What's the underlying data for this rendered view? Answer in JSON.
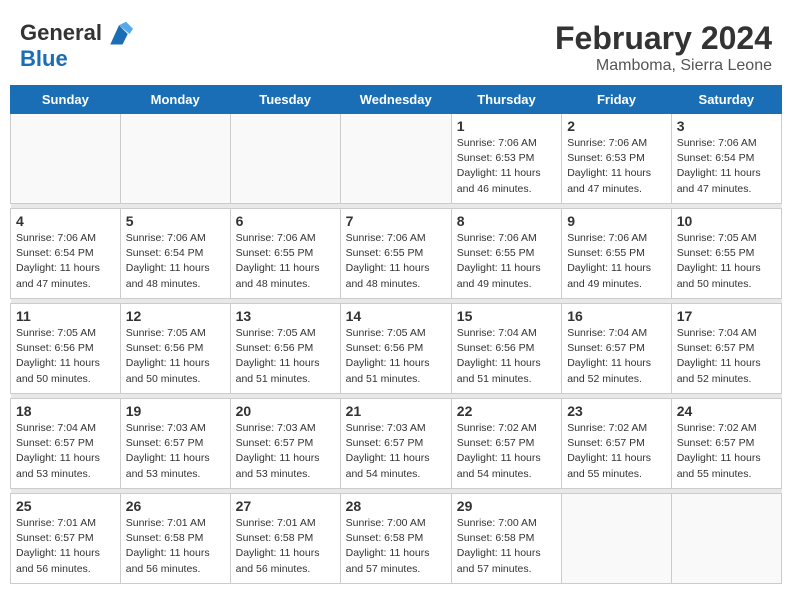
{
  "header": {
    "logo_line1": "General",
    "logo_line2": "Blue",
    "month_year": "February 2024",
    "location": "Mamboma, Sierra Leone"
  },
  "weekdays": [
    "Sunday",
    "Monday",
    "Tuesday",
    "Wednesday",
    "Thursday",
    "Friday",
    "Saturday"
  ],
  "weeks": [
    [
      {
        "day": "",
        "info": ""
      },
      {
        "day": "",
        "info": ""
      },
      {
        "day": "",
        "info": ""
      },
      {
        "day": "",
        "info": ""
      },
      {
        "day": "1",
        "info": "Sunrise: 7:06 AM\nSunset: 6:53 PM\nDaylight: 11 hours\nand 46 minutes."
      },
      {
        "day": "2",
        "info": "Sunrise: 7:06 AM\nSunset: 6:53 PM\nDaylight: 11 hours\nand 47 minutes."
      },
      {
        "day": "3",
        "info": "Sunrise: 7:06 AM\nSunset: 6:54 PM\nDaylight: 11 hours\nand 47 minutes."
      }
    ],
    [
      {
        "day": "4",
        "info": "Sunrise: 7:06 AM\nSunset: 6:54 PM\nDaylight: 11 hours\nand 47 minutes."
      },
      {
        "day": "5",
        "info": "Sunrise: 7:06 AM\nSunset: 6:54 PM\nDaylight: 11 hours\nand 48 minutes."
      },
      {
        "day": "6",
        "info": "Sunrise: 7:06 AM\nSunset: 6:55 PM\nDaylight: 11 hours\nand 48 minutes."
      },
      {
        "day": "7",
        "info": "Sunrise: 7:06 AM\nSunset: 6:55 PM\nDaylight: 11 hours\nand 48 minutes."
      },
      {
        "day": "8",
        "info": "Sunrise: 7:06 AM\nSunset: 6:55 PM\nDaylight: 11 hours\nand 49 minutes."
      },
      {
        "day": "9",
        "info": "Sunrise: 7:06 AM\nSunset: 6:55 PM\nDaylight: 11 hours\nand 49 minutes."
      },
      {
        "day": "10",
        "info": "Sunrise: 7:05 AM\nSunset: 6:55 PM\nDaylight: 11 hours\nand 50 minutes."
      }
    ],
    [
      {
        "day": "11",
        "info": "Sunrise: 7:05 AM\nSunset: 6:56 PM\nDaylight: 11 hours\nand 50 minutes."
      },
      {
        "day": "12",
        "info": "Sunrise: 7:05 AM\nSunset: 6:56 PM\nDaylight: 11 hours\nand 50 minutes."
      },
      {
        "day": "13",
        "info": "Sunrise: 7:05 AM\nSunset: 6:56 PM\nDaylight: 11 hours\nand 51 minutes."
      },
      {
        "day": "14",
        "info": "Sunrise: 7:05 AM\nSunset: 6:56 PM\nDaylight: 11 hours\nand 51 minutes."
      },
      {
        "day": "15",
        "info": "Sunrise: 7:04 AM\nSunset: 6:56 PM\nDaylight: 11 hours\nand 51 minutes."
      },
      {
        "day": "16",
        "info": "Sunrise: 7:04 AM\nSunset: 6:57 PM\nDaylight: 11 hours\nand 52 minutes."
      },
      {
        "day": "17",
        "info": "Sunrise: 7:04 AM\nSunset: 6:57 PM\nDaylight: 11 hours\nand 52 minutes."
      }
    ],
    [
      {
        "day": "18",
        "info": "Sunrise: 7:04 AM\nSunset: 6:57 PM\nDaylight: 11 hours\nand 53 minutes."
      },
      {
        "day": "19",
        "info": "Sunrise: 7:03 AM\nSunset: 6:57 PM\nDaylight: 11 hours\nand 53 minutes."
      },
      {
        "day": "20",
        "info": "Sunrise: 7:03 AM\nSunset: 6:57 PM\nDaylight: 11 hours\nand 53 minutes."
      },
      {
        "day": "21",
        "info": "Sunrise: 7:03 AM\nSunset: 6:57 PM\nDaylight: 11 hours\nand 54 minutes."
      },
      {
        "day": "22",
        "info": "Sunrise: 7:02 AM\nSunset: 6:57 PM\nDaylight: 11 hours\nand 54 minutes."
      },
      {
        "day": "23",
        "info": "Sunrise: 7:02 AM\nSunset: 6:57 PM\nDaylight: 11 hours\nand 55 minutes."
      },
      {
        "day": "24",
        "info": "Sunrise: 7:02 AM\nSunset: 6:57 PM\nDaylight: 11 hours\nand 55 minutes."
      }
    ],
    [
      {
        "day": "25",
        "info": "Sunrise: 7:01 AM\nSunset: 6:57 PM\nDaylight: 11 hours\nand 56 minutes."
      },
      {
        "day": "26",
        "info": "Sunrise: 7:01 AM\nSunset: 6:58 PM\nDaylight: 11 hours\nand 56 minutes."
      },
      {
        "day": "27",
        "info": "Sunrise: 7:01 AM\nSunset: 6:58 PM\nDaylight: 11 hours\nand 56 minutes."
      },
      {
        "day": "28",
        "info": "Sunrise: 7:00 AM\nSunset: 6:58 PM\nDaylight: 11 hours\nand 57 minutes."
      },
      {
        "day": "29",
        "info": "Sunrise: 7:00 AM\nSunset: 6:58 PM\nDaylight: 11 hours\nand 57 minutes."
      },
      {
        "day": "",
        "info": ""
      },
      {
        "day": "",
        "info": ""
      }
    ]
  ]
}
